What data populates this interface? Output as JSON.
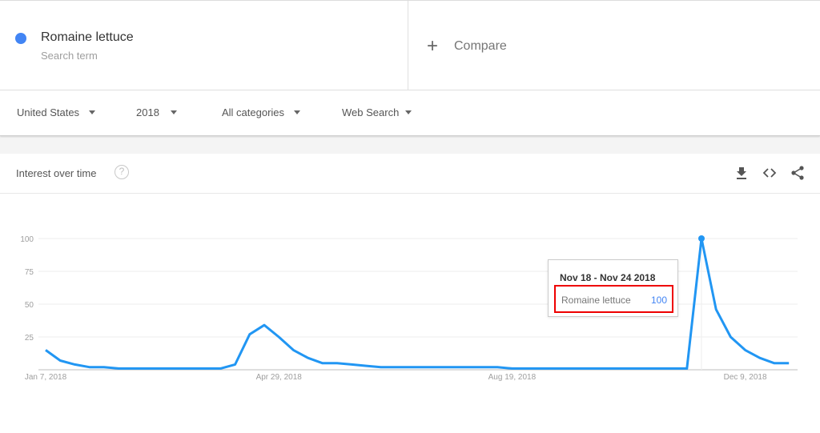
{
  "search_term": {
    "name": "Romaine lettuce",
    "subtitle": "Search term",
    "color": "#4285f4"
  },
  "compare": {
    "icon": "plus-icon",
    "label": "Compare"
  },
  "filters": [
    {
      "label": "United States",
      "icon": "caret-down-icon"
    },
    {
      "label": "2018",
      "icon": "caret-down-icon"
    },
    {
      "label": "All categories",
      "icon": "caret-down-icon"
    },
    {
      "label": "Web Search",
      "icon": "caret-down-icon"
    }
  ],
  "card": {
    "title": "Interest over time",
    "help_icon": "help-circle-icon",
    "actions": [
      "download-icon",
      "embed-code-icon",
      "share-icon"
    ]
  },
  "tooltip": {
    "date": "Nov 18 - Nov 24 2018",
    "term": "Romaine lettuce",
    "value": "100"
  },
  "chart_data": {
    "type": "line",
    "title": "Interest over time",
    "xlabel": "",
    "ylabel": "",
    "ylim": [
      0,
      100
    ],
    "yticks": [
      25,
      50,
      75,
      100
    ],
    "ytick_labels": [
      "25",
      "50",
      "75",
      "100"
    ],
    "xtick_labels": [
      "Jan 7, 2018",
      "Apr 29, 2018",
      "Aug 19, 2018",
      "Dec 9, 2018"
    ],
    "xtick_week_index": [
      0,
      16,
      32,
      48
    ],
    "grid": true,
    "legend": "none",
    "highlight_week_index": 45,
    "series": [
      {
        "name": "Romaine lettuce",
        "color": "#2196f3",
        "x_start": "Jan 7, 2018",
        "x_step": "1 week",
        "values": [
          15,
          7,
          4,
          2,
          2,
          1,
          1,
          1,
          1,
          1,
          1,
          1,
          1,
          4,
          27,
          34,
          25,
          15,
          9,
          5,
          5,
          4,
          3,
          2,
          2,
          2,
          2,
          2,
          2,
          2,
          2,
          2,
          1,
          1,
          1,
          1,
          1,
          1,
          1,
          1,
          1,
          1,
          1,
          1,
          1,
          100,
          46,
          25,
          15,
          9,
          5,
          5
        ]
      }
    ]
  }
}
